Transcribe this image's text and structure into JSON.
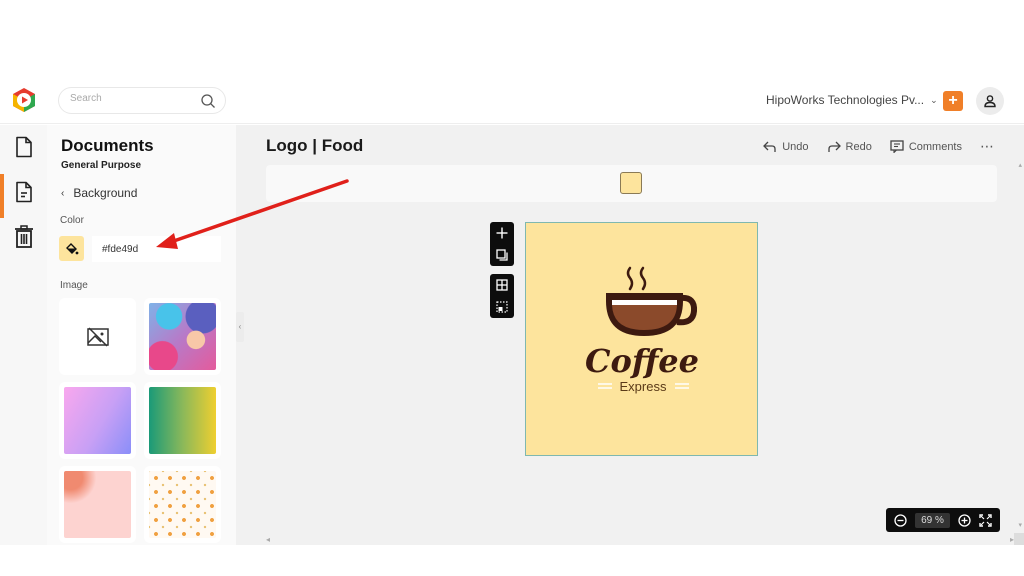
{
  "topbar": {
    "search_placeholder": "Search",
    "org_name": "HipoWorks Technologies Pv...",
    "add_label": "+"
  },
  "rail": {
    "items": [
      {
        "name": "documents",
        "icon": "file-icon",
        "active": false
      },
      {
        "name": "templates",
        "icon": "file-text-icon",
        "active": true
      },
      {
        "name": "trash",
        "icon": "trash-icon",
        "active": false
      }
    ]
  },
  "panel": {
    "title": "Documents",
    "subtitle": "General Purpose",
    "back_label": "Background",
    "color_label": "Color",
    "color_value": "#fde49d",
    "image_label": "Image",
    "images": [
      {
        "name": "no-image"
      },
      {
        "name": "bokeh-pink-blue"
      },
      {
        "name": "gradient-pink-violet"
      },
      {
        "name": "gradient-green-yellow"
      },
      {
        "name": "floral-pink"
      },
      {
        "name": "fruit-pattern"
      }
    ]
  },
  "main": {
    "doc_title": "Logo | Food",
    "actions": {
      "undo": "Undo",
      "redo": "Redo",
      "comments": "Comments",
      "more": "⋯"
    },
    "canvas": {
      "background": "#fde49d",
      "logo_title": "Coffee",
      "logo_subtitle": "Express"
    },
    "zoom": {
      "value": "69",
      "unit": "%"
    }
  },
  "colors": {
    "accent": "#f07f28",
    "canvas_bg": "#fde49d",
    "coffee_dark": "#3d1a10",
    "coffee_mid": "#8b4a2b"
  }
}
